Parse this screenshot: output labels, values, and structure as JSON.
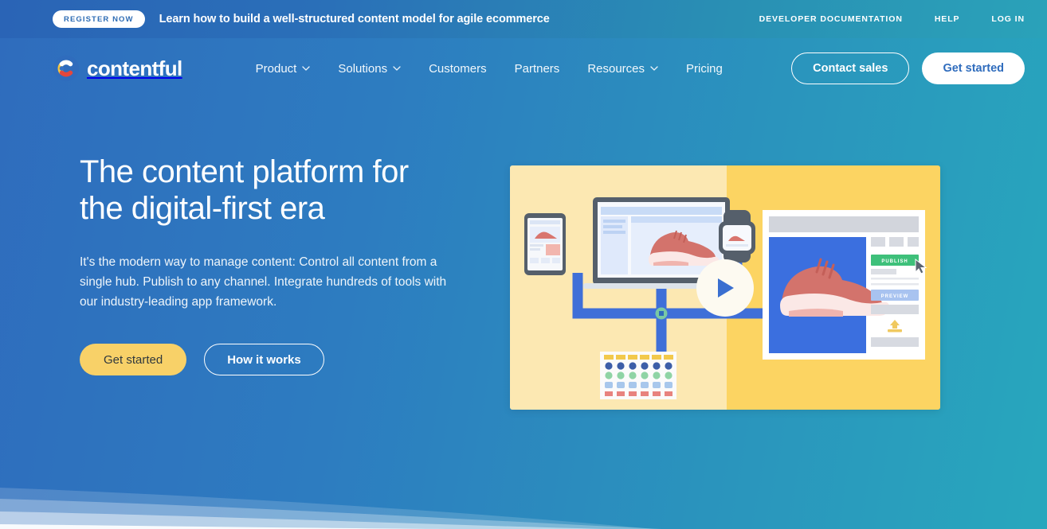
{
  "announcement": {
    "pill_label": "REGISTER NOW",
    "message": "Learn how to build a well-structured content model for agile ecommerce",
    "links": [
      {
        "label": "DEVELOPER DOCUMENTATION",
        "name": "developer-documentation"
      },
      {
        "label": "HELP",
        "name": "help"
      },
      {
        "label": "LOG IN",
        "name": "log-in"
      }
    ]
  },
  "header": {
    "logo_text": "contentful",
    "nav": [
      {
        "label": "Product",
        "has_chevron": true
      },
      {
        "label": "Solutions",
        "has_chevron": true
      },
      {
        "label": "Customers",
        "has_chevron": false
      },
      {
        "label": "Partners",
        "has_chevron": false
      },
      {
        "label": "Resources",
        "has_chevron": true
      },
      {
        "label": "Pricing",
        "has_chevron": false
      }
    ],
    "contact_sales_label": "Contact sales",
    "get_started_label": "Get started"
  },
  "hero": {
    "title_line1": "The content platform for",
    "title_line2": "the digital-first era",
    "subtitle": "It's the modern way to manage content: Control all content from a single hub. Publish to any channel. Integrate hundreds of tools with our industry-leading app framework.",
    "primary_cta": "Get started",
    "secondary_cta": "How it works"
  },
  "video": {
    "play_label": "play-video",
    "publish_label": "PUBLISH",
    "preview_label": "PREVIEW",
    "bg_left": "#fce8b2",
    "bg_right": "#fcd462",
    "connector_color": "#3f6fd8",
    "product_bg": "#3b6fdf"
  },
  "colors": {
    "gradient_start": "#2f6cbd",
    "gradient_end": "#28a7bd",
    "accent_yellow": "#f8d168",
    "white": "#ffffff",
    "publish_green": "#3ec07a",
    "preview_blue": "#a8c3f0"
  }
}
